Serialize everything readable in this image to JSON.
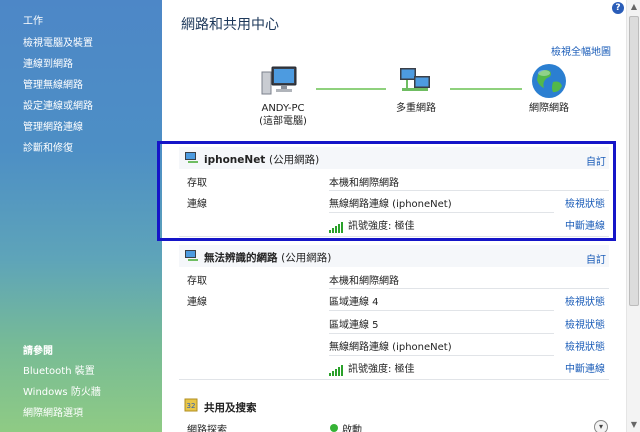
{
  "sidebar": {
    "tasks": [
      "工作",
      "檢視電腦及裝置",
      "連線到網路",
      "管理無線網路",
      "設定連線或網路",
      "管理網路連線",
      "診斷和修復"
    ],
    "see_also_title": "請參閱",
    "see_also": [
      "Bluetooth 裝置",
      "Windows 防火牆",
      "網際網路選項"
    ]
  },
  "header": {
    "title": "網路和共用中心",
    "full_map": "檢視全幅地圖",
    "help": "?"
  },
  "map": {
    "pc_name": "ANDY-PC",
    "pc_sub": "(這部電腦)",
    "multi": "多重網路",
    "internet": "網際網路"
  },
  "network1": {
    "name": "iphoneNet",
    "type": "(公用網路)",
    "customize": "自訂",
    "access_label": "存取",
    "access_value": "本機和網際網路",
    "connection_label": "連線",
    "connection_value": "無線網路連線 (iphoneNet)",
    "view_status": "檢視狀態",
    "signal": "訊號強度: 極佳",
    "disconnect": "中斷連線"
  },
  "network2": {
    "name": "無法辨識的網路",
    "type": "(公用網路)",
    "customize": "自訂",
    "access_label": "存取",
    "access_value": "本機和網際網路",
    "connection_label": "連線",
    "rows": [
      {
        "value": "區域連線 4",
        "action": "檢視狀態"
      },
      {
        "value": "區域連線 5",
        "action": "檢視狀態"
      },
      {
        "value": "無線網路連線 (iphoneNet)",
        "action": "檢視狀態"
      }
    ],
    "signal": "訊號強度: 極佳",
    "disconnect": "中斷連線"
  },
  "sharing": {
    "title": "共用及搜索",
    "row_label": "網路探索",
    "row_value": "啟動"
  }
}
